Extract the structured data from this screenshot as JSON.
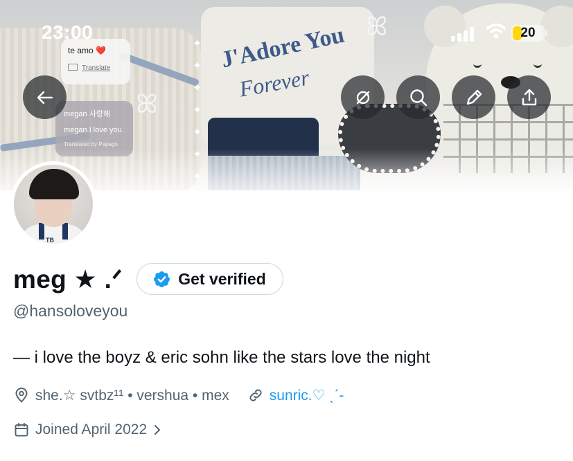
{
  "status_bar": {
    "time": "23:00",
    "battery": "20"
  },
  "banner": {
    "hoodie_line1": "J'Adore You",
    "hoodie_line2": "Forever",
    "bubble_a": {
      "text": "te amo",
      "heart": "❤️",
      "translate": "Translate"
    },
    "bubble_b": {
      "line1": "megan 사랑해",
      "line2": "megan I love you.",
      "note": "Translated by Papago"
    }
  },
  "actions": {
    "back": "arrow-left-icon",
    "hide": "hide-icon",
    "search": "search-icon",
    "edit": "pencil-icon",
    "share": "share-icon"
  },
  "avatar": {
    "jersey_text": "TB"
  },
  "profile": {
    "name": "meg ★ .ᐟ",
    "verify_label": "Get verified",
    "handle": "@hansoloveyou",
    "bio": "— i love the boyz & eric sohn like the stars love the night",
    "location": "she.☆ svtbz¹¹ • vershua • mex",
    "link": "sunric.♡ ˎˊ-",
    "joined": "Joined April 2022"
  },
  "colors": {
    "link_blue": "#1d9bf0",
    "secondary_text": "#536471",
    "primary_text": "#0f1419",
    "verified_badge": "#1d9bf0"
  }
}
